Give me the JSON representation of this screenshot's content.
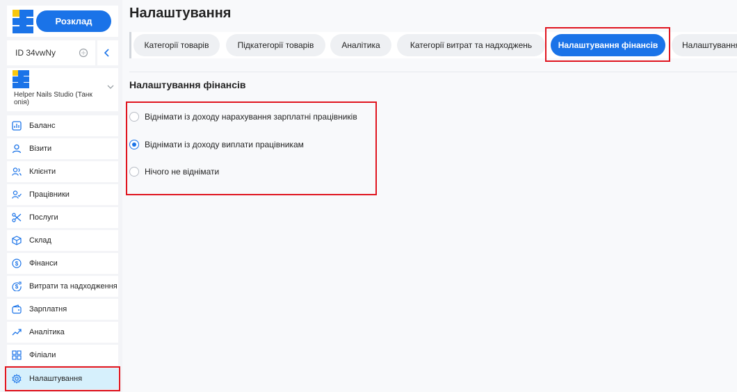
{
  "sidebar": {
    "schedule_button": "Розклад",
    "account_id": "ID 34vwNy",
    "studio_name": "Helper Nails Studio (Танк опія)",
    "items": [
      {
        "label": "Баланс",
        "icon": "chart-icon"
      },
      {
        "label": "Візити",
        "icon": "person-icon"
      },
      {
        "label": "Клієнти",
        "icon": "people-icon"
      },
      {
        "label": "Працівники",
        "icon": "person-check-icon"
      },
      {
        "label": "Послуги",
        "icon": "scissors-icon"
      },
      {
        "label": "Склад",
        "icon": "box-icon"
      },
      {
        "label": "Фінанси",
        "icon": "dollar-icon"
      },
      {
        "label": "Витрати та надходження",
        "icon": "dollar-refresh-icon"
      },
      {
        "label": "Зарплатня",
        "icon": "wallet-icon"
      },
      {
        "label": "Аналітика",
        "icon": "trend-icon"
      },
      {
        "label": "Філіали",
        "icon": "grid-icon"
      },
      {
        "label": "Налаштування",
        "icon": "gear-icon",
        "active": true
      }
    ]
  },
  "main": {
    "title": "Налаштування",
    "tabs": [
      {
        "label": "Категорії товарів"
      },
      {
        "label": "Підкатегорії товарів"
      },
      {
        "label": "Аналітика"
      },
      {
        "label": "Категорії витрат та надходжень"
      },
      {
        "label": "Налаштування фінансів",
        "active": true
      },
      {
        "label": "Налаштування"
      }
    ],
    "section_title": "Налаштування фінансів",
    "options": [
      {
        "label": "Віднімати із доходу нарахування зарплатні працівників",
        "checked": false
      },
      {
        "label": "Віднімати із доходу виплати працівникам",
        "checked": true
      },
      {
        "label": "Нічого не віднімати",
        "checked": false
      }
    ]
  },
  "colors": {
    "accent": "#1a73e8",
    "highlight": "#e0141e",
    "active_nav_bg": "#d6f0fc",
    "logo_blue": "#1a73e8",
    "logo_yellow": "#f9c80e"
  }
}
